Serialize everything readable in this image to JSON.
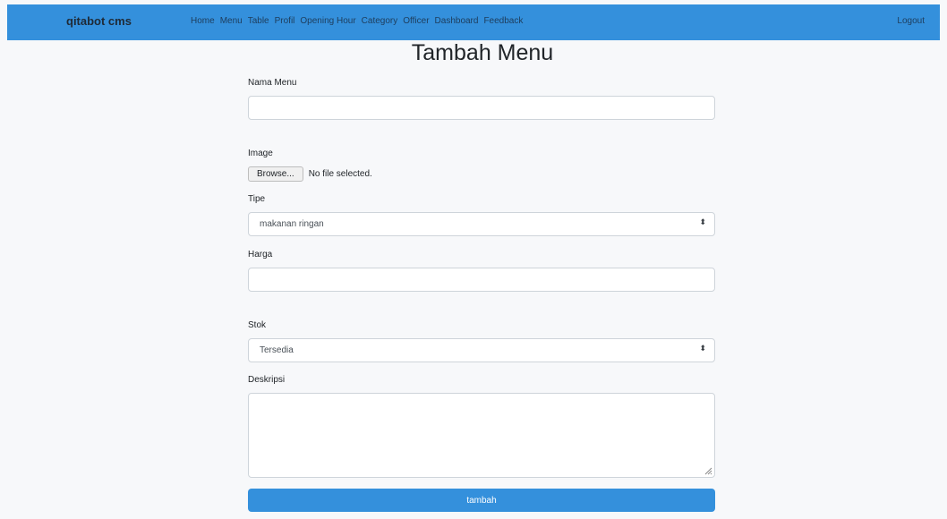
{
  "navbar": {
    "brand": "qitabot cms",
    "links": [
      "Home",
      "Menu",
      "Table",
      "Profil",
      "Opening Hour",
      "Category",
      "Officer",
      "Dashboard",
      "Feedback"
    ],
    "logout": "Logout"
  },
  "page_title": "Tambah Menu",
  "form": {
    "nama_menu": {
      "label": "Nama Menu",
      "value": ""
    },
    "image": {
      "label": "Image",
      "browse_label": "Browse...",
      "file_status": "No file selected."
    },
    "tipe": {
      "label": "Tipe",
      "selected": "makanan ringan"
    },
    "harga": {
      "label": "Harga",
      "value": ""
    },
    "stok": {
      "label": "Stok",
      "selected": "Tersedia"
    },
    "deskripsi": {
      "label": "Deskripsi",
      "value": ""
    },
    "submit_label": "tambah"
  },
  "colors": {
    "primary": "#3490dc",
    "background": "#f7f8fa"
  }
}
